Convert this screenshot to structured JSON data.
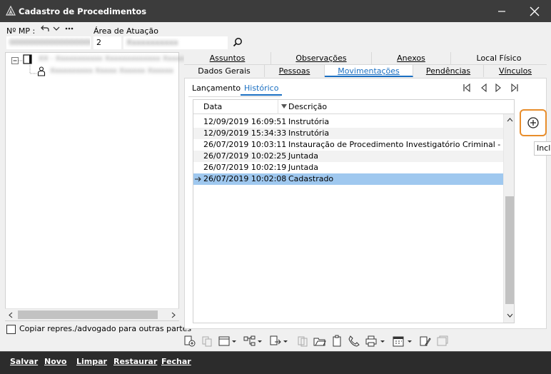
{
  "window": {
    "title": "Cadastro de Procedimentos",
    "close_glyph": "✕"
  },
  "top": {
    "mp_label": "Nº MP :",
    "area_label": "Área de Atuação",
    "area_code": "2",
    "mp_value": "00000000000000000",
    "area_name": "Xxxxxxxxxxx"
  },
  "tree": {
    "nodes": [
      {
        "label": "XX - Xxxxxxxxxxx Xxxxxxxxxxxxx Xxxxx"
      },
      {
        "label": "Xxxxxxxxxx Xxxxx Xxxxxx Xxxxxx"
      }
    ]
  },
  "checkbox": {
    "label": "Copiar repres./advogado para outras partes",
    "checked": false
  },
  "tabs_row1": [
    "Assuntos",
    "Observações",
    "Anexos",
    "Local Físico"
  ],
  "tabs_row2": [
    "Dados Gerais",
    "Pessoas",
    "Movimentações",
    "Pendências",
    "Vínculos"
  ],
  "active_tab": "Movimentações",
  "subtabs": [
    "Lançamento",
    "Histórico"
  ],
  "grid": {
    "columns": [
      "Data",
      "Descrição"
    ],
    "rows": [
      {
        "date": "12/09/2019 16:09:51",
        "desc": "Instrutória"
      },
      {
        "date": "12/09/2019 15:34:33",
        "desc": "Instrutória"
      },
      {
        "date": "26/07/2019 10:03:11",
        "desc": "Instauração de Procedimento Investigatório Criminal - PIC"
      },
      {
        "date": "26/07/2019 10:02:25",
        "desc": "Juntada"
      },
      {
        "date": "26/07/2019 10:02:19",
        "desc": "Juntada"
      },
      {
        "date": "26/07/2019 10:02:08",
        "desc": "Cadastrado"
      }
    ],
    "selected_index": 5
  },
  "tooltip": "Incl",
  "footer": [
    "Salvar",
    "Novo",
    "Limpar",
    "Restaurar",
    "Fechar"
  ],
  "colors": {
    "accent": "#1a6fc2",
    "highlight": "#e88d2b",
    "selected_row": "#9fc8ef",
    "titlebar": "#3c3c3c",
    "footer": "#2c2c2c"
  }
}
